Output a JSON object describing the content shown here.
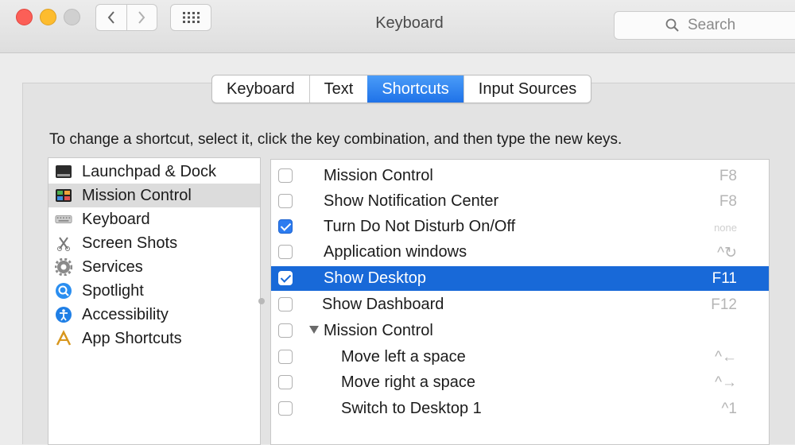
{
  "window": {
    "title": "Keyboard"
  },
  "search": {
    "placeholder": "Search"
  },
  "tabs": [
    {
      "label": "Keyboard",
      "active": false
    },
    {
      "label": "Text",
      "active": false
    },
    {
      "label": "Shortcuts",
      "active": true
    },
    {
      "label": "Input Sources",
      "active": false
    }
  ],
  "instruction": "To change a shortcut, select it, click the key combination, and then type the new keys.",
  "categories": [
    {
      "label": "Launchpad & Dock",
      "icon": "launchpad-dock-icon"
    },
    {
      "label": "Mission Control",
      "icon": "mission-control-icon",
      "selected": true
    },
    {
      "label": "Keyboard",
      "icon": "keyboard-icon"
    },
    {
      "label": "Screen Shots",
      "icon": "screen-shots-icon"
    },
    {
      "label": "Services",
      "icon": "services-gear-icon"
    },
    {
      "label": "Spotlight",
      "icon": "spotlight-icon"
    },
    {
      "label": "Accessibility",
      "icon": "accessibility-icon"
    },
    {
      "label": "App Shortcuts",
      "icon": "app-shortcuts-icon"
    }
  ],
  "shortcuts": [
    {
      "label": "Mission Control",
      "key": "F8",
      "checked": false
    },
    {
      "label": "Show Notification Center",
      "key": "F8",
      "checked": false
    },
    {
      "label": "Turn Do Not Disturb On/Off",
      "key": "none",
      "checked": true
    },
    {
      "label": "Application windows",
      "key": "^↻",
      "checked": false
    },
    {
      "label": "Show Desktop",
      "key": "F11",
      "checked": true,
      "selected": true
    },
    {
      "label": "Show Dashboard",
      "key": "F12",
      "checked": false
    },
    {
      "label": "Mission Control",
      "key": "",
      "checked": false,
      "group": true
    },
    {
      "label": "Move left a space",
      "key": "^←",
      "checked": false,
      "indent": true
    },
    {
      "label": "Move right a space",
      "key": "^→",
      "checked": false,
      "indent": true
    },
    {
      "label": "Switch to Desktop 1",
      "key": "^1",
      "checked": false,
      "indent": true
    }
  ],
  "colors": {
    "accent": "#1869d8",
    "close": "#fc5f57",
    "minimize": "#fdbc2e"
  }
}
